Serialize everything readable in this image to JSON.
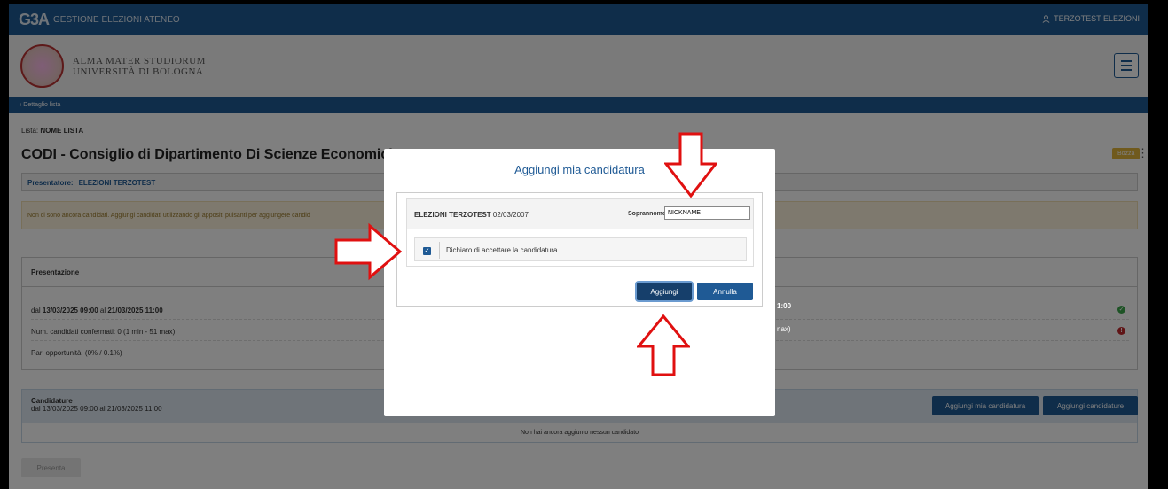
{
  "topbar": {
    "logo": "G3A",
    "app_title": "GESTIONE ELEZIONI ATENEO",
    "user": "TERZOTEST ELEZIONI"
  },
  "header": {
    "university_line1": "ALMA MATER STUDIORUM",
    "university_line2": "UNIVERSITÀ DI BOLOGNA"
  },
  "breadcrumb": {
    "back_label": "Dettaglio lista"
  },
  "list": {
    "label": "Lista:",
    "name": "NOME LISTA",
    "title": "CODI - Consiglio di Dipartimento Di Scienze Economiche - C",
    "status_badge": "Bozza"
  },
  "presenter": {
    "label": "Presentatore:",
    "value": "ELEZIONI TERZOTEST"
  },
  "warning": "Non ci sono ancora candidati. Aggiungi candidati utilizzando gli appositi pulsanti per aggiungere candid",
  "presentazione": {
    "title": "Presentazione",
    "date_prefix": "dal",
    "date_from": "13/03/2025 09:00",
    "date_mid": "al",
    "date_to": "21/03/2025 11:00",
    "confirmed": "Num. candidati confermati: 0 (1 min - 51 max)",
    "pari": "Pari opportunità: (0% / 0.1%)",
    "right_frag_1": "1:00",
    "right_frag_2": "nax)"
  },
  "candidature": {
    "title": "Candidature",
    "dates": "dal 13/03/2025 09:00 al 21/03/2025 11:00",
    "empty": "Non hai ancora aggiunto nessun candidato",
    "btn_add_mine": "Aggiungi mia candidatura",
    "btn_add": "Aggiungi candidature"
  },
  "presenta_button": "Presenta",
  "modal": {
    "title": "Aggiungi mia candidatura",
    "candidate_name": "ELEZIONI TERZOTEST",
    "candidate_date": "02/03/2007",
    "nickname_label": "Soprannome:",
    "nickname_value": "NICKNAME",
    "accept_label": "Dichiaro di accettare la candidatura",
    "accept_checked": true,
    "btn_confirm": "Aggiungi",
    "btn_cancel": "Annulla"
  },
  "colors": {
    "primary": "#1f5a95",
    "annotation_arrow": "#e01010",
    "badge": "#e0b43a"
  }
}
